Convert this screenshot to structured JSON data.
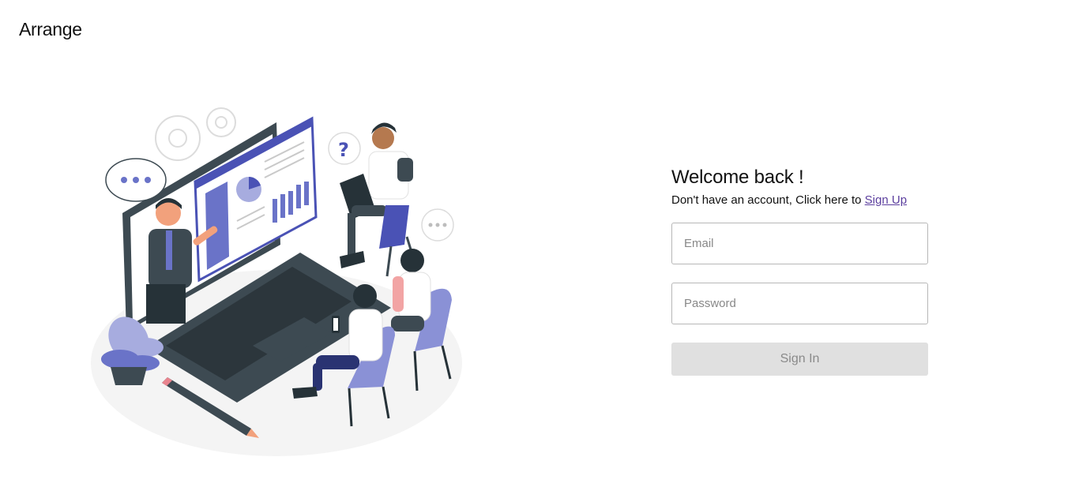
{
  "brand": {
    "name": "Arrange"
  },
  "login": {
    "title": "Welcome back !",
    "signup_prompt": "Don't have an account, Click here to ",
    "signup_link": "Sign Up",
    "email_placeholder": "Email",
    "email_value": "",
    "password_placeholder": "Password",
    "password_value": "",
    "submit_label": "Sign In"
  },
  "colors": {
    "accent": "#5b3e9e",
    "illustration_primary": "#6a73c8",
    "illustration_light": "#a7acdf",
    "laptop_dark": "#3d4a52",
    "button_disabled_bg": "#e0e0e0"
  },
  "illustration": {
    "icon": "online-meeting-illustration"
  }
}
